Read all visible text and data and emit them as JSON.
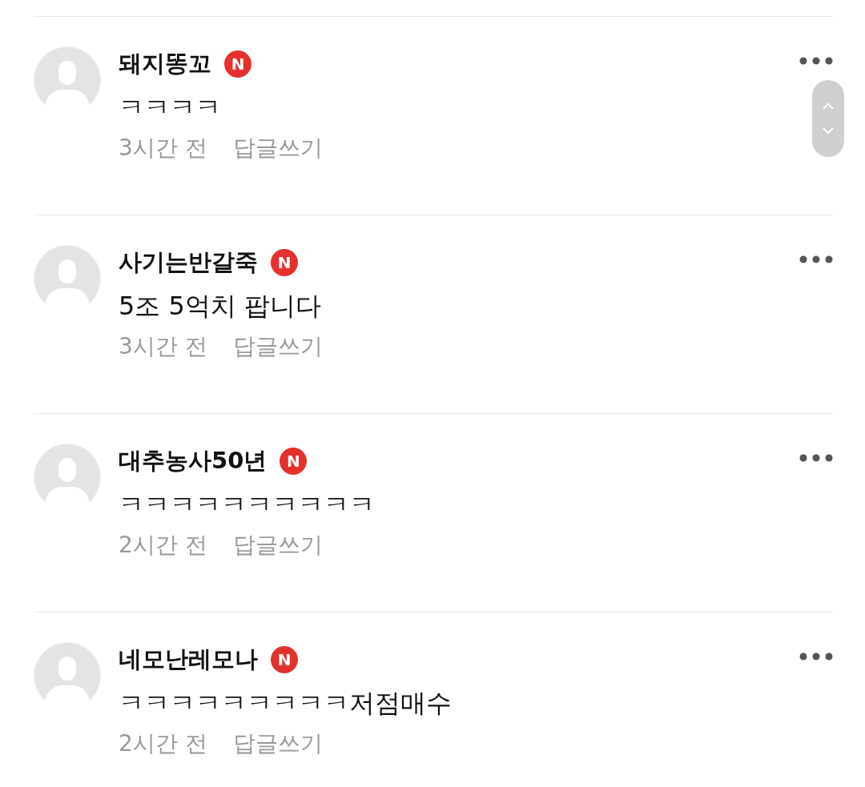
{
  "comments": [
    {
      "author": "돼지똥꼬",
      "badge": "N",
      "text": "ㅋㅋㅋㅋ",
      "time": "3시간 전",
      "reply": "답글쓰기"
    },
    {
      "author": "사기는반갈죽",
      "badge": "N",
      "text": "5조 5억치 팝니다",
      "time": "3시간 전",
      "reply": "답글쓰기"
    },
    {
      "author": "대추농사50년",
      "badge": "N",
      "text": "ㅋㅋㅋㅋㅋㅋㅋㅋㅋㅋ",
      "time": "2시간 전",
      "reply": "답글쓰기"
    },
    {
      "author": "네모난레모나",
      "badge": "N",
      "text": "ㅋㅋㅋㅋㅋㅋㅋㅋㅋ저점매수",
      "time": "2시간 전",
      "reply": "답글쓰기"
    }
  ]
}
